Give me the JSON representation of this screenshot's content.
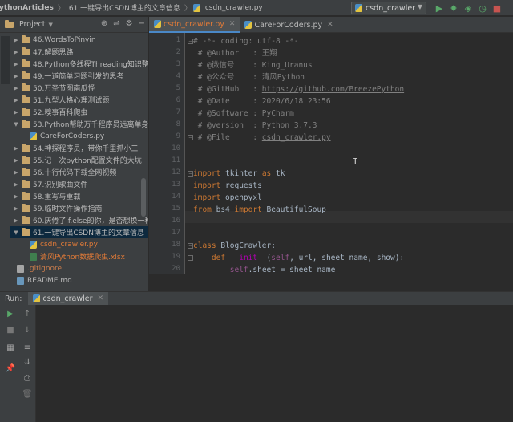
{
  "titlebar": {
    "project": "ythonArticles",
    "folder": "61.一键导出CSDN博主的文章信息",
    "file": "csdn_crawler.py",
    "run_config": "csdn_crawler"
  },
  "project_panel": {
    "title": "Project",
    "tree": [
      {
        "label": "46.WordsToPinyin",
        "kind": "folder",
        "expanded": false,
        "indent": 0,
        "color": ""
      },
      {
        "label": "47.解题思路",
        "kind": "folder",
        "expanded": false,
        "indent": 0,
        "color": ""
      },
      {
        "label": "48.Python多线程Threading知识整",
        "kind": "folder",
        "expanded": false,
        "indent": 0,
        "color": ""
      },
      {
        "label": "49.一道简单习题引发的思考",
        "kind": "folder",
        "expanded": false,
        "indent": 0,
        "color": ""
      },
      {
        "label": "50.万圣节图南瓜怪",
        "kind": "folder",
        "expanded": false,
        "indent": 0,
        "color": ""
      },
      {
        "label": "51.九型人格心理测试题",
        "kind": "folder",
        "expanded": false,
        "indent": 0,
        "color": ""
      },
      {
        "label": "52.糗事百科爬虫",
        "kind": "folder",
        "expanded": false,
        "indent": 0,
        "color": ""
      },
      {
        "label": "53.Python帮助万千程序员远离单身",
        "kind": "folder",
        "expanded": true,
        "indent": 0,
        "color": ""
      },
      {
        "label": "CareForCoders.py",
        "kind": "py",
        "expanded": null,
        "indent": 1,
        "color": ""
      },
      {
        "label": "54.神探程序员，带你千里抓小三",
        "kind": "folder",
        "expanded": false,
        "indent": 0,
        "color": ""
      },
      {
        "label": "55.记一次python配置文件的大坑",
        "kind": "folder",
        "expanded": false,
        "indent": 0,
        "color": ""
      },
      {
        "label": "56.十行代码下载全网视频",
        "kind": "folder",
        "expanded": false,
        "indent": 0,
        "color": ""
      },
      {
        "label": "57.识别歌曲文件",
        "kind": "folder",
        "expanded": false,
        "indent": 0,
        "color": ""
      },
      {
        "label": "58.重写与重载",
        "kind": "folder",
        "expanded": false,
        "indent": 0,
        "color": ""
      },
      {
        "label": "59.临时文件操作指南",
        "kind": "folder",
        "expanded": false,
        "indent": 0,
        "color": ""
      },
      {
        "label": "60.厌倦了if.else的你，是否想换一种",
        "kind": "folder",
        "expanded": false,
        "indent": 0,
        "color": ""
      },
      {
        "label": "61.一键导出CSDN博主的文章信息",
        "kind": "folder",
        "expanded": true,
        "indent": 0,
        "color": "",
        "selected": true
      },
      {
        "label": "csdn_crawler.py",
        "kind": "py",
        "expanded": null,
        "indent": 1,
        "color": "orange"
      },
      {
        "label": "清风Python数据爬虫.xlsx",
        "kind": "xls",
        "expanded": null,
        "indent": 1,
        "color": "orange"
      },
      {
        "label": ".gitignore",
        "kind": "git",
        "expanded": null,
        "indent": -1,
        "color": "brown"
      },
      {
        "label": "README.md",
        "kind": "md",
        "expanded": null,
        "indent": -1,
        "color": ""
      }
    ]
  },
  "editor": {
    "tabs": [
      {
        "label": "csdn_crawler.py",
        "active": true
      },
      {
        "label": "CareForCoders.py",
        "active": false
      }
    ],
    "lines": [
      [
        {
          "t": "# -*- coding: utf-8 -*-",
          "c": "comment"
        }
      ],
      [
        {
          "t": " # @Author   : 王翔",
          "c": "comment"
        }
      ],
      [
        {
          "t": " # @微信号    : King_Uranus",
          "c": "comment"
        }
      ],
      [
        {
          "t": " # @公众号    : 清风Python",
          "c": "comment"
        }
      ],
      [
        {
          "t": " # @GitHub   : ",
          "c": "comment"
        },
        {
          "t": "https://github.com/BreezePython",
          "c": "link"
        }
      ],
      [
        {
          "t": " # @Date     : 2020/6/18 23:56",
          "c": "comment"
        }
      ],
      [
        {
          "t": " # @Software : PyCharm",
          "c": "comment"
        }
      ],
      [
        {
          "t": " # @version  : Python 3.7.3",
          "c": "comment"
        }
      ],
      [
        {
          "t": " # @File     : ",
          "c": "comment"
        },
        {
          "t": "csdn_crawler.py",
          "c": "link"
        }
      ],
      [],
      [],
      [
        {
          "t": "import",
          "c": "kw"
        },
        {
          "t": " tkinter ",
          "c": "mod"
        },
        {
          "t": "as",
          "c": "kw"
        },
        {
          "t": " tk",
          "c": "mod"
        }
      ],
      [
        {
          "t": "import",
          "c": "kw"
        },
        {
          "t": " requests",
          "c": "mod"
        }
      ],
      [
        {
          "t": "import",
          "c": "kw"
        },
        {
          "t": " openpyxl",
          "c": "mod"
        }
      ],
      [
        {
          "t": "from",
          "c": "kw"
        },
        {
          "t": " bs4 ",
          "c": "mod"
        },
        {
          "t": "import",
          "c": "kw"
        },
        {
          "t": " BeautifulSoup",
          "c": "mod"
        }
      ],
      [],
      [],
      [
        {
          "t": "class",
          "c": "kw"
        },
        {
          "t": " BlogCrawler:",
          "c": "mod"
        }
      ],
      [
        {
          "t": "    ",
          "c": "mod"
        },
        {
          "t": "def",
          "c": "kw"
        },
        {
          "t": " ",
          "c": "mod"
        },
        {
          "t": "__init__",
          "c": "magic"
        },
        {
          "t": "(",
          "c": "mod"
        },
        {
          "t": "self",
          "c": "self"
        },
        {
          "t": ", url, sheet_name, show):",
          "c": "mod"
        }
      ],
      [
        {
          "t": "        ",
          "c": "mod"
        },
        {
          "t": "self",
          "c": "self"
        },
        {
          "t": ".sheet = sheet_name",
          "c": "mod"
        }
      ]
    ]
  },
  "run_panel": {
    "title": "Run:",
    "tab": "csdn_crawler"
  }
}
